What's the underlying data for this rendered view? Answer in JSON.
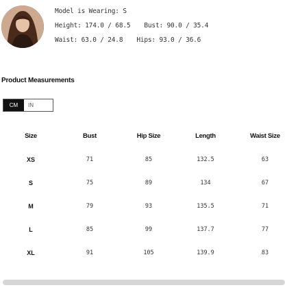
{
  "model": {
    "wearing": "Model is Wearing: S",
    "height": "Height: 174.0 / 68.5",
    "bust": "Bust: 90.0 / 35.4",
    "waist": "Waist: 63.0 / 24.8",
    "hips": "Hips: 93.0 / 36.6"
  },
  "product_measurements": {
    "title": "Product Measurements",
    "units": {
      "cm": "CM",
      "in": "IN",
      "selected": "CM"
    }
  },
  "table": {
    "headers": [
      "Size",
      "Bust",
      "Hip Size",
      "Length",
      "Waist Size"
    ],
    "rows": [
      [
        "XS",
        "71",
        "85",
        "132.5",
        "63"
      ],
      [
        "S",
        "75",
        "89",
        "134",
        "67"
      ],
      [
        "M",
        "79",
        "93",
        "135.5",
        "71"
      ],
      [
        "L",
        "85",
        "99",
        "137.7",
        "77"
      ],
      [
        "XL",
        "91",
        "105",
        "139.9",
        "83"
      ]
    ]
  }
}
